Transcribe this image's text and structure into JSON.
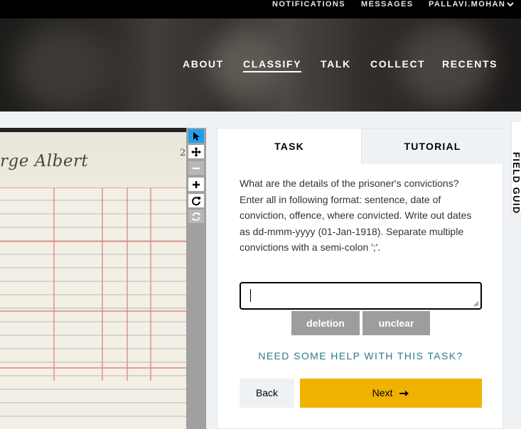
{
  "topbar": {
    "notifications": "NOTIFICATIONS",
    "messages": "MESSAGES",
    "username": "PALLAVI.MOHAN"
  },
  "nav": {
    "about": "ABOUT",
    "classify": "CLASSIFY",
    "talk": "TALK",
    "collect": "COLLECT",
    "recents": "RECENTS"
  },
  "subject": {
    "handwriting": "rge Albert",
    "page_number": "2"
  },
  "toolbar": {
    "icons": [
      "pointer-icon",
      "move-icon",
      "zoom-out-icon",
      "zoom-in-icon",
      "rotate-icon",
      "reset-icon"
    ]
  },
  "task": {
    "tab_task": "TASK",
    "tab_tutorial": "TUTORIAL",
    "question": "What are the details of the prisoner's convictions? Enter all in following format: sentence, date of conviction, offence, where convicted. Write out dates as dd-mmm-yyyy (01-Jan-1918). Separate multiple convictions with a semi-colon ';'.",
    "answer_value": "",
    "tag_deletion": "deletion",
    "tag_unclear": "unclear",
    "help_link": "NEED SOME HELP WITH THIS TASK?",
    "back_label": "Back",
    "next_label": "Next"
  },
  "field_guide": {
    "label": "FIELD GUIDE"
  },
  "colors": {
    "next_button": "#f0b200",
    "help_link": "#2e7a80",
    "active_tool": "#1da1f2",
    "tag_button": "#9d9d9d"
  }
}
